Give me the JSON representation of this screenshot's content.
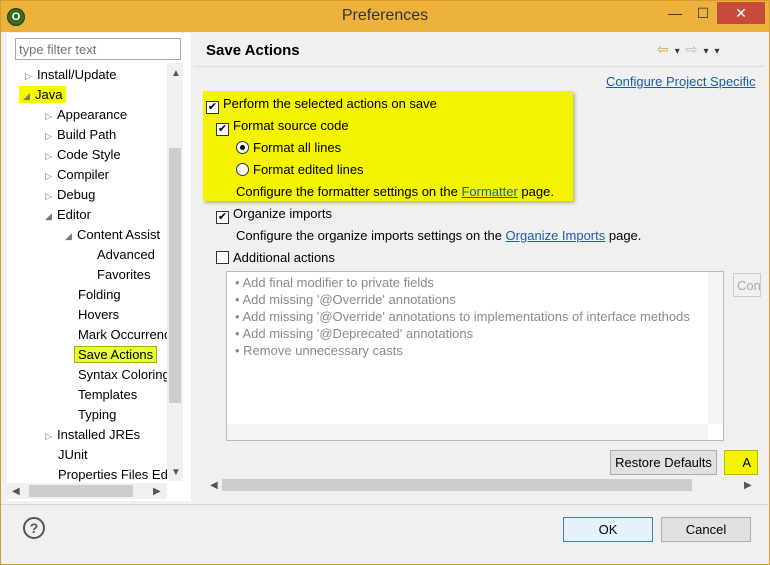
{
  "window": {
    "title": "Preferences",
    "min_glyph": "—",
    "max_glyph": "☐",
    "close_glyph": "✕",
    "app_icon_glyph": "O"
  },
  "filter": {
    "placeholder": "type filter text"
  },
  "tree": {
    "items": [
      {
        "label": "Install/Update",
        "twisty": "▷"
      },
      {
        "label": "Java",
        "twisty": "◢"
      },
      {
        "label": "Appearance",
        "twisty": "▷"
      },
      {
        "label": "Build Path",
        "twisty": "▷"
      },
      {
        "label": "Code Style",
        "twisty": "▷"
      },
      {
        "label": "Compiler",
        "twisty": "▷"
      },
      {
        "label": "Debug",
        "twisty": "▷"
      },
      {
        "label": "Editor",
        "twisty": "◢"
      },
      {
        "label": "Content Assist",
        "twisty": "◢"
      },
      {
        "label": "Advanced",
        "twisty": ""
      },
      {
        "label": "Favorites",
        "twisty": ""
      },
      {
        "label": "Folding",
        "twisty": ""
      },
      {
        "label": "Hovers",
        "twisty": ""
      },
      {
        "label": "Mark Occurrences",
        "twisty": ""
      },
      {
        "label": "Save Actions",
        "twisty": ""
      },
      {
        "label": "Syntax Coloring",
        "twisty": ""
      },
      {
        "label": "Templates",
        "twisty": ""
      },
      {
        "label": "Typing",
        "twisty": ""
      },
      {
        "label": "Installed JREs",
        "twisty": "▷"
      },
      {
        "label": "JUnit",
        "twisty": ""
      },
      {
        "label": "Properties Files Editor",
        "twisty": ""
      }
    ]
  },
  "page": {
    "title": "Save Actions",
    "configure_project_link": "Configure Project Specific",
    "perform_label": "Perform the selected actions on save",
    "format_label": "Format source code",
    "format_all_label": "Format all lines",
    "format_edited_label": "Format edited lines",
    "formatter_text_pre": "Configure the formatter settings on the ",
    "formatter_link": "Formatter",
    "formatter_text_post": " page.",
    "organize_label": "Organize imports",
    "organize_text_pre": "Configure the organize imports settings on the ",
    "organize_link": "Organize Imports",
    "organize_text_post": " page.",
    "additional_label": "Additional actions",
    "additional_items": [
      "Add final modifier to private fields",
      "Add missing '@Override' annotations",
      "Add missing '@Override' annotations to implementations of interface methods",
      "Add missing '@Deprecated' annotations",
      "Remove unnecessary casts"
    ],
    "configure_button": "Con",
    "restore_button": "Restore Defaults",
    "apply_button": "A",
    "check_glyph": "✔"
  },
  "nav": {
    "back": "⇦",
    "forward": "⇨",
    "down": "▾"
  },
  "footer": {
    "help_glyph": "?",
    "ok": "OK",
    "cancel": "Cancel"
  },
  "colors": {
    "highlight": "#f4f400",
    "titlebar": "#edb23e",
    "link": "#1a5cae"
  }
}
